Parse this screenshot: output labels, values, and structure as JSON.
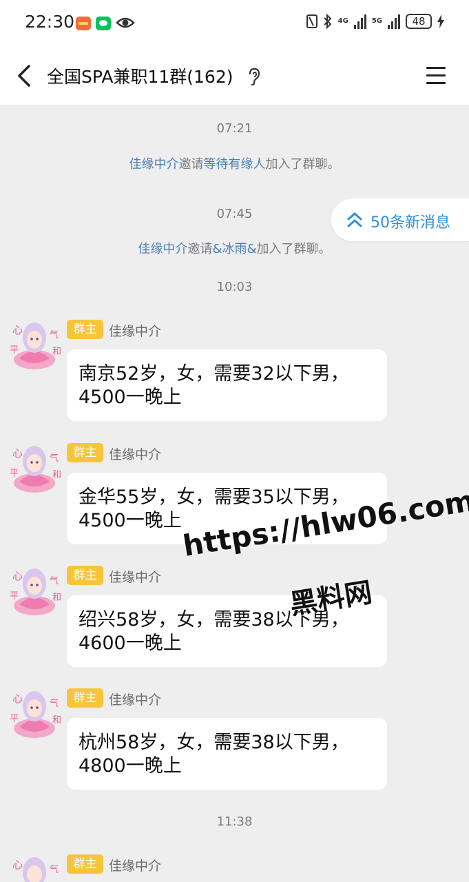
{
  "status_bar": {
    "time": "22:30",
    "net1": "4G",
    "net2": "5G",
    "battery": "48"
  },
  "header": {
    "title": "全国SPA兼职11群(162)"
  },
  "new_messages": {
    "label": "50条新消息"
  },
  "timestamps": [
    "07:21",
    "07:45",
    "10:03",
    "11:38"
  ],
  "system_messages": [
    {
      "inviter": "佳缘中介",
      "verb": "邀请",
      "invitee": "等待有缘人",
      "tail": "加入了群聊。"
    },
    {
      "inviter": "佳缘中介",
      "verb": "邀请",
      "invitee": "&冰雨&",
      "tail": "加入了群聊。"
    }
  ],
  "messages": [
    {
      "role": "群主",
      "sender": "佳缘中介",
      "line1": "南京52岁，女，需要32以下男，",
      "line2": "4500一晚上"
    },
    {
      "role": "群主",
      "sender": "佳缘中介",
      "line1": "金华55岁，女，需要35以下男，",
      "line2": "4500一晚上"
    },
    {
      "role": "群主",
      "sender": "佳缘中介",
      "line1": "绍兴58岁，女，需要38以下男，",
      "line2": "4600一晚上"
    },
    {
      "role": "群主",
      "sender": "佳缘中介",
      "line1": "杭州58岁，女，需要38以下男，",
      "line2": "4800一晚上"
    },
    {
      "role": "群主",
      "sender": "佳缘中介"
    }
  ],
  "avatar_text": [
    "心",
    "平",
    "气",
    "和"
  ],
  "watermark": {
    "url": "https://hlw06.com",
    "name": "黑料网"
  },
  "colors": {
    "background": "#eeeeef",
    "bubble": "#ffffff",
    "badge": "#f7c53a",
    "link_name": "#4c7fb3",
    "new_messages": "#2e8fd9"
  }
}
